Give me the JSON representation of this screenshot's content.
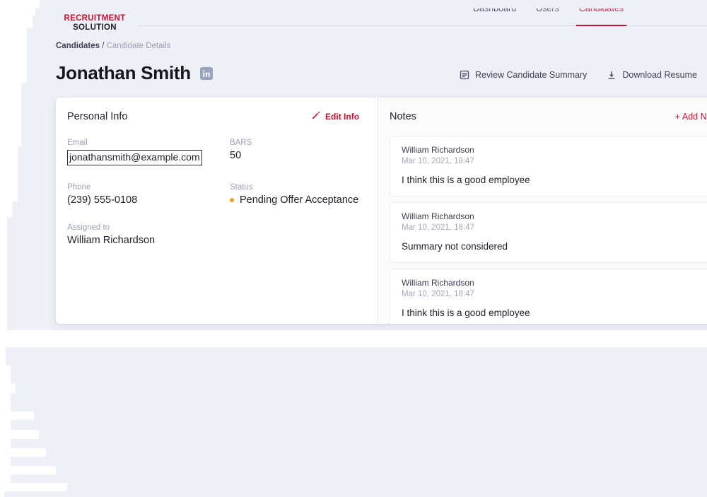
{
  "brand": {
    "line1": "RECRUITMENT",
    "line2": "SOLUTION",
    "accent": "#c8102e"
  },
  "nav": {
    "items": [
      {
        "label": "Dashboard",
        "active": false
      },
      {
        "label": "Users",
        "active": false
      },
      {
        "label": "Candidates",
        "active": true
      }
    ]
  },
  "breadcrumb": {
    "parent": "Candidates",
    "separator": "/",
    "current": "Candidate Details"
  },
  "title": {
    "name": "Jonathan Smith",
    "linkedin_icon": "linkedin-icon"
  },
  "actions": [
    {
      "label": "Review Candidate Summary",
      "icon": "document-summary-icon"
    },
    {
      "label": "Download Resume",
      "icon": "download-icon"
    }
  ],
  "personal_info": {
    "heading": "Personal Info",
    "edit_label": "Edit Info",
    "edit_icon": "pencil-icon",
    "fields": {
      "email": {
        "label": "Email",
        "value": "jonathansmith@example.com"
      },
      "bars": {
        "label": "BARS",
        "value": "50"
      },
      "phone": {
        "label": "Phone",
        "value": "(239) 555-0108"
      },
      "status": {
        "label": "Status",
        "value": "Pending Offer Acceptance",
        "dot_color": "#f0a01e"
      },
      "assigned_to": {
        "label": "Assigned to",
        "value": "William Richardson"
      }
    }
  },
  "notes": {
    "heading": "Notes",
    "add_label": "+ Add Note",
    "items": [
      {
        "author": "William Richardson",
        "date": "Mar 10, 2021, 18:47",
        "body": "I think this is a good employee"
      },
      {
        "author": "William Richardson",
        "date": "Mar 10, 2021, 18:47",
        "body": "Summary not considered"
      },
      {
        "author": "William Richardson",
        "date": "Mar 10, 2021, 18:47",
        "body": "I think this is a good employee"
      }
    ]
  },
  "colors": {
    "page_background": "#eef0f7",
    "card_background": "#ffffff",
    "notes_background": "#fbfbfc",
    "brand_red": "#c8102e",
    "status_orange": "#f0a01e",
    "linkedin_gray": "#9aa3bd"
  }
}
